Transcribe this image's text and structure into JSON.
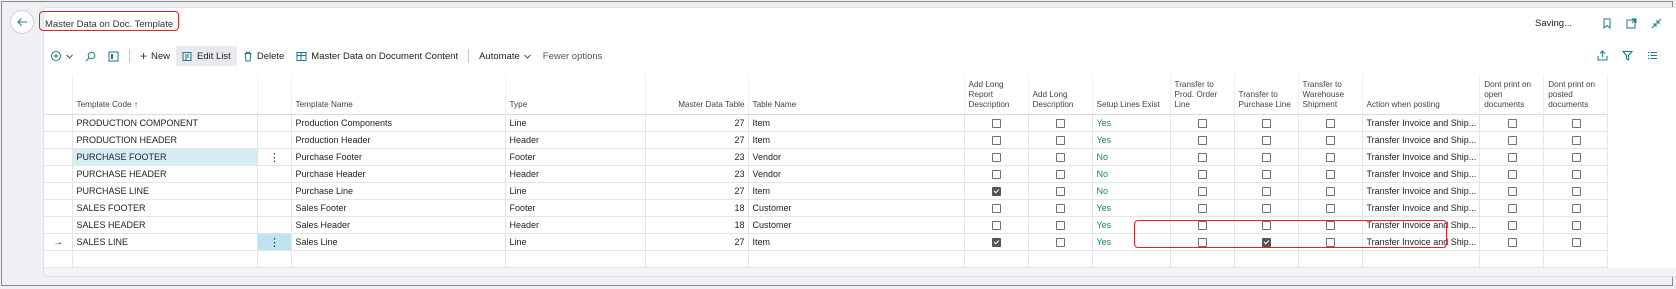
{
  "page": {
    "title": "Master Data on Doc. Template",
    "status": "Saving..."
  },
  "actions": {
    "new_label": "New",
    "edit_list_label": "Edit List",
    "delete_label": "Delete",
    "master_data_label": "Master Data on Document Content",
    "automate_label": "Automate",
    "fewer_options_label": "Fewer options"
  },
  "columns": {
    "template_code": "Template Code ↑",
    "template_name": "Template Name",
    "type": "Type",
    "master_data_table": "Master Data Table",
    "table_name": "Table Name",
    "add_long_report_desc": "Add Long Report Description",
    "add_long_desc": "Add Long Description",
    "setup_lines_exist": "Setup Lines Exist",
    "transfer_prod_order": "Transfer to Prod. Order Line",
    "transfer_purchase": "Transfer to Purchase Line",
    "transfer_warehouse": "Transfer to Warehouse Shipment",
    "action_when_posting": "Action when posting",
    "dont_print_open": "Dont print on open documents",
    "dont_print_posted": "Dont print on posted documents"
  },
  "rows": [
    {
      "code": "PRODUCTION COMPONENT",
      "name": "Production Components",
      "type": "Line",
      "table": "27",
      "table_name": "Item",
      "long_report": false,
      "long_desc": false,
      "setup": "Yes",
      "prod": false,
      "purch": false,
      "whse": false,
      "action": "Transfer Invoice and Ship...",
      "open": false,
      "posted": false
    },
    {
      "code": "PRODUCTION HEADER",
      "name": "Production Header",
      "type": "Header",
      "table": "27",
      "table_name": "Item",
      "long_report": false,
      "long_desc": false,
      "setup": "Yes",
      "prod": false,
      "purch": false,
      "whse": false,
      "action": "Transfer Invoice and Ship...",
      "open": false,
      "posted": false
    },
    {
      "code": "PURCHASE FOOTER",
      "name": "Purchase Footer",
      "type": "Footer",
      "table": "23",
      "table_name": "Vendor",
      "long_report": false,
      "long_desc": false,
      "setup": "No",
      "prod": false,
      "purch": false,
      "whse": false,
      "action": "Transfer Invoice and Ship...",
      "open": false,
      "posted": false
    },
    {
      "code": "PURCHASE HEADER",
      "name": "Purchase Header",
      "type": "Header",
      "table": "23",
      "table_name": "Vendor",
      "long_report": false,
      "long_desc": false,
      "setup": "No",
      "prod": false,
      "purch": false,
      "whse": false,
      "action": "Transfer Invoice and Ship...",
      "open": false,
      "posted": false
    },
    {
      "code": "PURCHASE LINE",
      "name": "Purchase Line",
      "type": "Line",
      "table": "27",
      "table_name": "Item",
      "long_report": true,
      "long_desc": false,
      "setup": "No",
      "prod": false,
      "purch": false,
      "whse": false,
      "action": "Transfer Invoice and Ship...",
      "open": false,
      "posted": false
    },
    {
      "code": "SALES FOOTER",
      "name": "Sales Footer",
      "type": "Footer",
      "table": "18",
      "table_name": "Customer",
      "long_report": false,
      "long_desc": false,
      "setup": "Yes",
      "prod": false,
      "purch": false,
      "whse": false,
      "action": "Transfer Invoice and Ship...",
      "open": false,
      "posted": false
    },
    {
      "code": "SALES HEADER",
      "name": "Sales Header",
      "type": "Header",
      "table": "18",
      "table_name": "Customer",
      "long_report": false,
      "long_desc": false,
      "setup": "Yes",
      "prod": false,
      "purch": false,
      "whse": false,
      "action": "Transfer Invoice and Ship...",
      "open": false,
      "posted": false
    },
    {
      "code": "SALES LINE",
      "name": "Sales Line",
      "type": "Line",
      "table": "27",
      "table_name": "Item",
      "long_report": true,
      "long_desc": false,
      "setup": "Yes",
      "prod": false,
      "purch": true,
      "whse": false,
      "action": "Transfer Invoice and Ship...",
      "open": false,
      "posted": false
    }
  ],
  "icons": {
    "back": "arrow-left-icon",
    "bookmark": "bookmark-icon",
    "open_new": "open-in-new-window-icon",
    "collapse": "collapse-icon",
    "share": "share-icon",
    "filter": "filter-icon",
    "list": "list-view-icon"
  },
  "colors": {
    "link": "#1c7a8c",
    "annotation": "#e2222b",
    "selection": "#d6edf3"
  }
}
